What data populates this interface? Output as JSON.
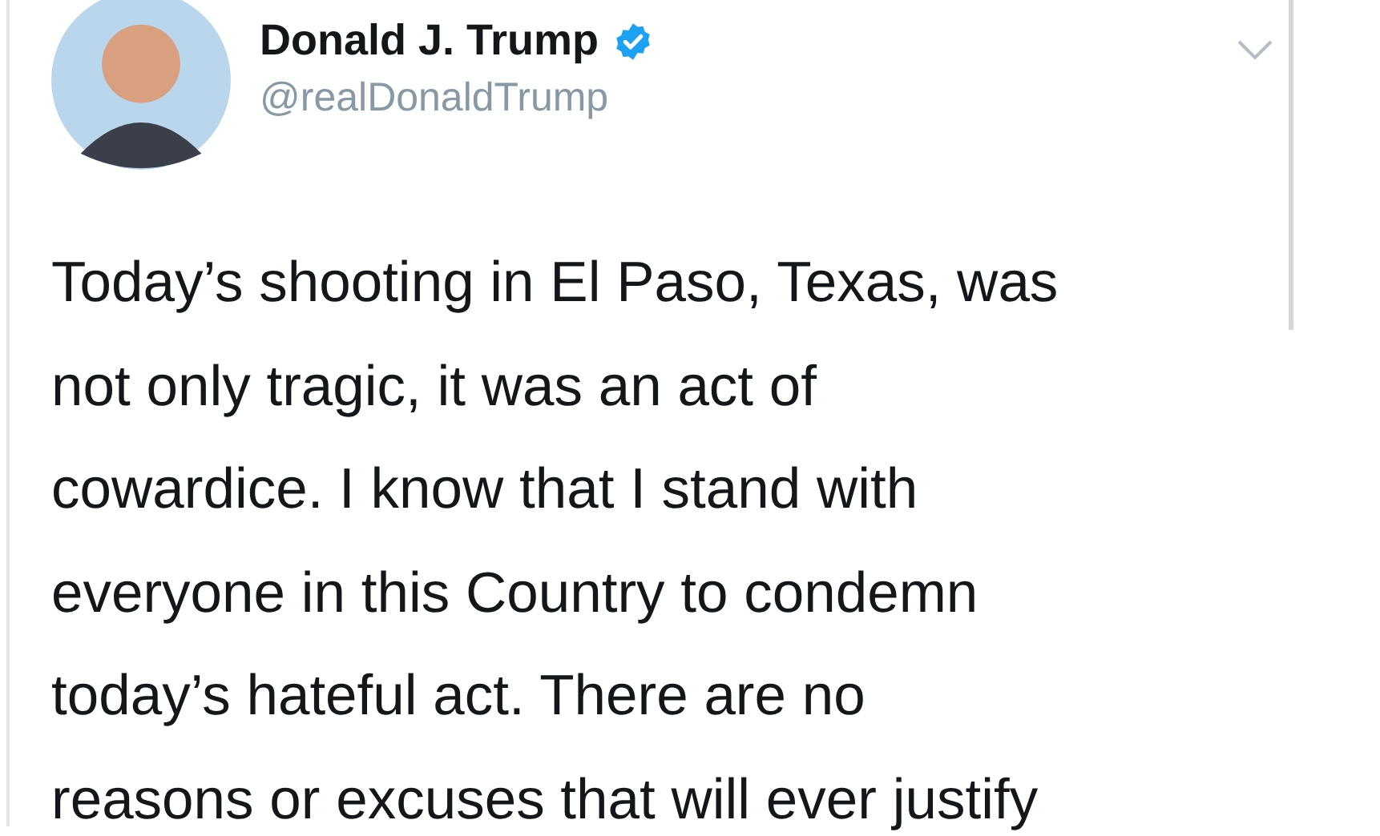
{
  "author": {
    "name": "Donald J. Trump",
    "verified": true,
    "handle": "@realDonaldTrump"
  },
  "tweet": {
    "text": "Today’s shooting in El Paso, Texas, was\nnot only tragic, it was an act of\ncowardice. I know that I stand with\neveryone in this Country to condemn\ntoday’s hateful act. There are no\nreasons or excuses that will ever justify"
  }
}
